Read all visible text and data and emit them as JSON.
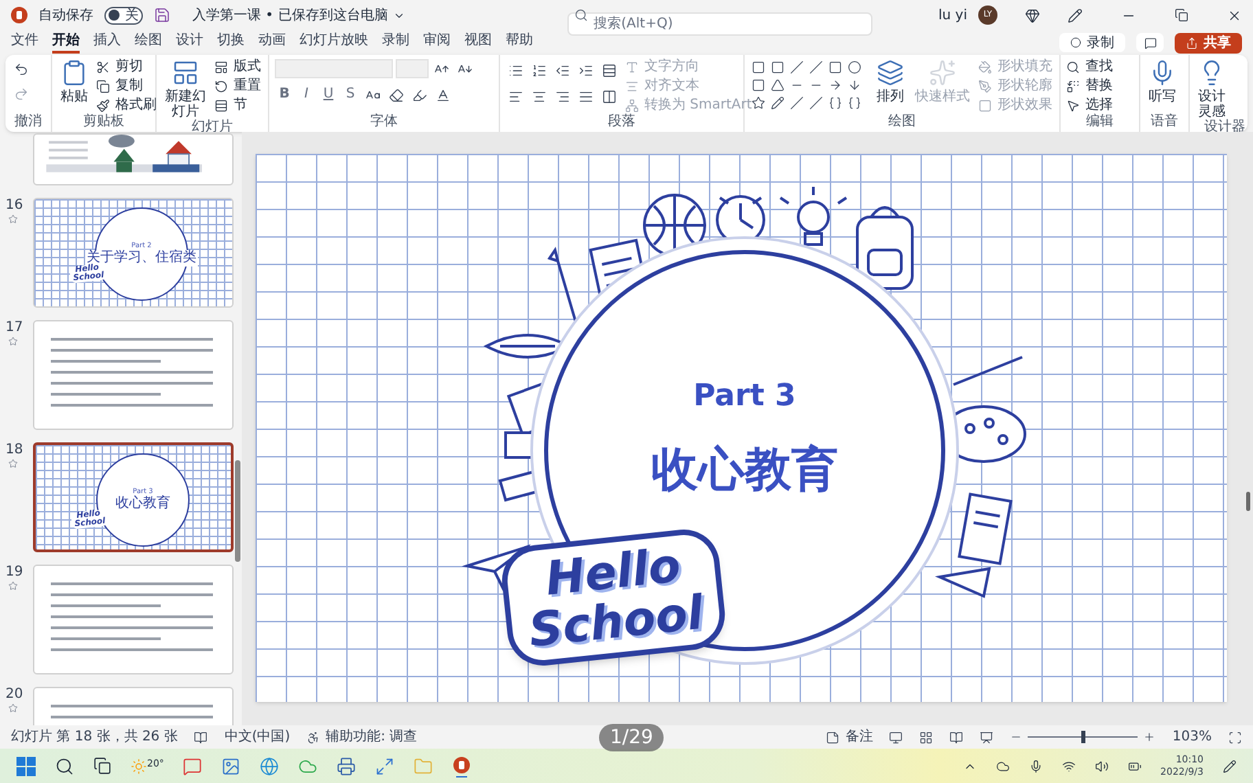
{
  "title_bar": {
    "autosave_label": "自动保存",
    "autosave_toggle": {
      "label": "关",
      "on": false
    },
    "document_title": "入学第一课 • 已保存到这台电脑",
    "search": {
      "placeholder": "搜索(Alt+Q)"
    },
    "user_name": "lu yi",
    "avatar_initials": "LY"
  },
  "ribbon_tabs": [
    {
      "label": "文件",
      "selected": false
    },
    {
      "label": "开始",
      "selected": true
    },
    {
      "label": "插入",
      "selected": false
    },
    {
      "label": "绘图",
      "selected": false
    },
    {
      "label": "设计",
      "selected": false
    },
    {
      "label": "切换",
      "selected": false
    },
    {
      "label": "动画",
      "selected": false
    },
    {
      "label": "幻灯片放映",
      "selected": false
    },
    {
      "label": "录制",
      "selected": false
    },
    {
      "label": "审阅",
      "selected": false
    },
    {
      "label": "视图",
      "selected": false
    },
    {
      "label": "帮助",
      "selected": false
    }
  ],
  "record_button": "录制",
  "share_button": "共享",
  "ribbon_groups": [
    {
      "kind": "undo",
      "label": "撤消"
    },
    {
      "kind": "clipboard",
      "label": "剪贴板",
      "large": [
        {
          "label": "粘贴",
          "disabled": false
        }
      ],
      "small": [
        {
          "label": "剪切",
          "disabled": false
        },
        {
          "label": "复制",
          "disabled": false
        },
        {
          "label": "格式刷",
          "disabled": false
        }
      ]
    },
    {
      "kind": "slides",
      "label": "幻灯片",
      "large": [
        {
          "label": "新建幻灯片",
          "disabled": false
        }
      ],
      "small": [
        {
          "label": "版式",
          "disabled": false
        },
        {
          "label": "重置",
          "disabled": false
        },
        {
          "label": "节",
          "disabled": false
        }
      ]
    },
    {
      "kind": "font",
      "label": "字体",
      "format_buttons": [
        "B",
        "I",
        "U",
        "S"
      ]
    },
    {
      "kind": "paragraph",
      "label": "段落",
      "small": [
        {
          "label": "文字方向",
          "disabled": true
        },
        {
          "label": "对齐文本",
          "disabled": true
        },
        {
          "label": "转换为 SmartArt",
          "disabled": true
        }
      ]
    },
    {
      "kind": "drawing",
      "label": "绘图",
      "large": [
        {
          "label": "排列",
          "disabled": false
        },
        {
          "label": "快速样式",
          "disabled": true
        }
      ],
      "small": [
        {
          "label": "形状填充",
          "disabled": true
        },
        {
          "label": "形状轮廓",
          "disabled": true
        },
        {
          "label": "形状效果",
          "disabled": true
        }
      ]
    },
    {
      "kind": "editing",
      "label": "编辑",
      "small": [
        {
          "label": "查找",
          "disabled": false
        },
        {
          "label": "替换",
          "disabled": false
        },
        {
          "label": "选择",
          "disabled": false
        }
      ]
    },
    {
      "kind": "voice",
      "label": "语音",
      "large": [
        {
          "label": "听写",
          "disabled": false
        }
      ]
    },
    {
      "kind": "designer",
      "label": "设计器",
      "large": [
        {
          "label": "设计灵感",
          "disabled": false
        }
      ]
    }
  ],
  "slides": [
    {
      "kind": "image",
      "selected": false
    },
    {
      "number": "16",
      "kind": "section",
      "part": "Part 2",
      "title": "关于学习、住宿类",
      "sticker_lines": [
        "Hello",
        "School"
      ],
      "selected": false
    },
    {
      "number": "17",
      "kind": "text",
      "selected": false
    },
    {
      "number": "18",
      "kind": "section",
      "part": "Part 3",
      "title": "收心教育",
      "sticker_lines": [
        "Hello",
        "School"
      ],
      "selected": true
    },
    {
      "number": "19",
      "kind": "text",
      "selected": false
    },
    {
      "number": "20",
      "kind": "text",
      "selected": false
    }
  ],
  "slide": {
    "part": "Part 3",
    "title": "收心教育",
    "sticker_lines": [
      "Hello",
      "School"
    ]
  },
  "status_bar": {
    "slide_position": "幻灯片 第 18 张，共 26 张",
    "language": "中文(中国)",
    "accessibility": "辅助功能: 调查",
    "notes_button": "备注",
    "zoom": {
      "level": 0.5,
      "reading": "103%"
    }
  },
  "page_counter": "1/29",
  "taskbar": {
    "weather": "20°",
    "time": "10:10",
    "date": "2022/9/3"
  }
}
